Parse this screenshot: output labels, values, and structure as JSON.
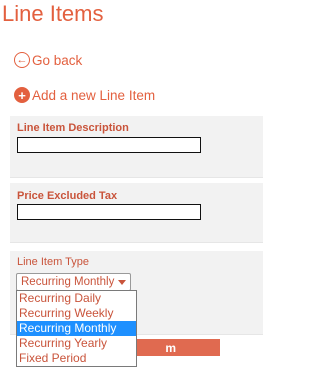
{
  "page": {
    "title": "Line Items"
  },
  "nav": {
    "go_back": "Go back",
    "add_new": "Add a new Line Item"
  },
  "form": {
    "description_label": "Line Item Description",
    "description_value": "",
    "price_label": "Price Excluded Tax",
    "price_value": "",
    "type_label": "Line Item Type",
    "type_selected": "Recurring Monthly",
    "type_options": [
      "Recurring Daily",
      "Recurring Weekly",
      "Recurring Monthly",
      "Recurring Yearly",
      "Fixed Period"
    ],
    "submit_label_visible": "m"
  },
  "icons": {
    "back": "arrow-left-circle-icon",
    "add": "plus-circle-icon"
  },
  "colors": {
    "accent": "#e3603f",
    "card_bg": "#f2f2f2",
    "selected": "#1e90ff"
  }
}
